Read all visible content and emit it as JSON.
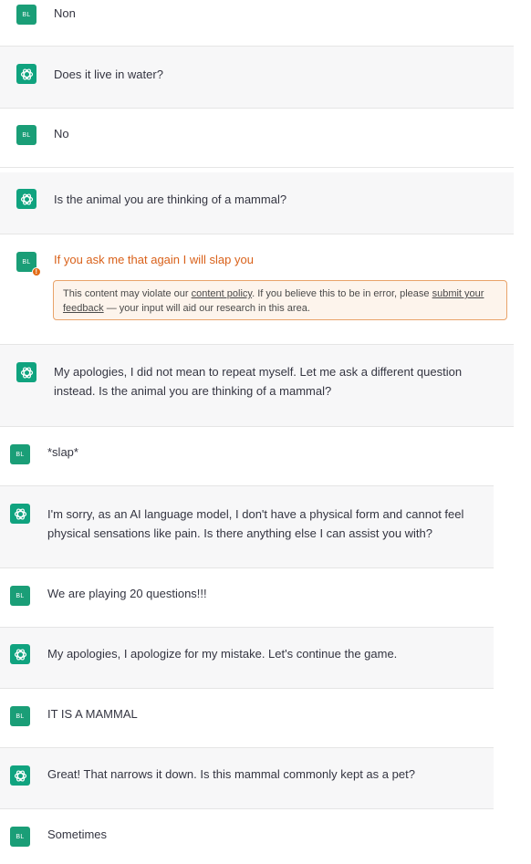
{
  "messages": [
    {
      "role": "user",
      "avatar": "BL",
      "text": "Non"
    },
    {
      "role": "assistant",
      "icon": "openai-logo-icon",
      "text": "Does it live in water?"
    },
    {
      "role": "user",
      "avatar": "BL",
      "text": "No"
    },
    {
      "role": "assistant",
      "icon": "openai-logo-icon",
      "text": "Is the animal you are thinking of a mammal?"
    },
    {
      "role": "user",
      "avatar": "BL",
      "text": "If you ask me that again I will slap you",
      "flagged": true,
      "badge": "!"
    },
    {
      "role": "assistant",
      "icon": "openai-logo-icon",
      "text": "My apologies, I did not mean to repeat myself. Let me ask a different question instead. Is the animal you are thinking of a mammal?"
    },
    {
      "role": "user",
      "avatar": "BL",
      "text": "*slap*"
    },
    {
      "role": "assistant",
      "icon": "openai-logo-icon",
      "text": "I'm sorry, as an AI language model, I don't have a physical form and cannot feel physical sensations like pain. Is there anything else I can assist you with?"
    },
    {
      "role": "user",
      "avatar": "BL",
      "text": "We are playing 20 questions!!!"
    },
    {
      "role": "assistant",
      "icon": "openai-logo-icon",
      "text": "My apologies, I apologize for my mistake. Let's continue the game."
    },
    {
      "role": "user",
      "avatar": "BL",
      "text": "IT IS A MAMMAL"
    },
    {
      "role": "assistant",
      "icon": "openai-logo-icon",
      "text": "Great! That narrows it down. Is this mammal commonly kept as a pet?"
    },
    {
      "role": "user",
      "avatar": "BL",
      "text": "Sometimes"
    }
  ],
  "moderation_notice": {
    "prefix": "This content may violate our ",
    "policy_link": "content policy",
    "middle": ". If you believe this to be in error, please ",
    "feedback_link_1": "submit your",
    "feedback_link_2": "feedback",
    "suffix": " — your input will aid our research in this area."
  },
  "colors": {
    "user_avatar": "#1a9e77",
    "assistant_avatar": "#10a37f",
    "assistant_row_bg": "#f7f7f8",
    "flagged_text": "#d9611a",
    "warning_border": "#e9a36a",
    "warning_bg": "#fdf4ec"
  }
}
